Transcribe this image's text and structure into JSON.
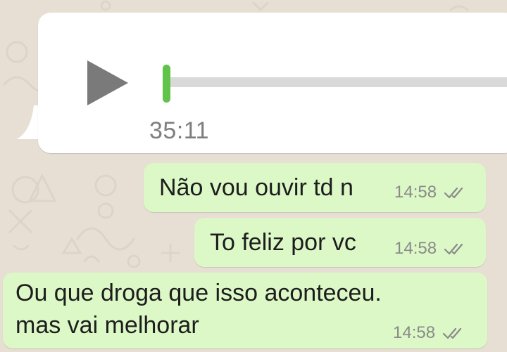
{
  "chat": {
    "voice_message": {
      "duration": "35:11",
      "progress": 0,
      "icon": "play-icon",
      "accent_color": "#60c34a",
      "track_color": "#d9d9d9"
    },
    "messages": [
      {
        "text": "Não vou ouvir td n",
        "time": "14:58",
        "status_icon": "double-check-icon"
      },
      {
        "text": "To feliz por vc",
        "time": "14:58",
        "status_icon": "double-check-icon"
      },
      {
        "text": "Ou que droga que isso aconteceu.\nmas vai melhorar",
        "time": "14:58",
        "status_icon": "double-check-icon"
      }
    ],
    "colors": {
      "background": "#e7dfd5",
      "incoming_bubble": "#ffffff",
      "outgoing_bubble": "#dcf8c6"
    }
  }
}
